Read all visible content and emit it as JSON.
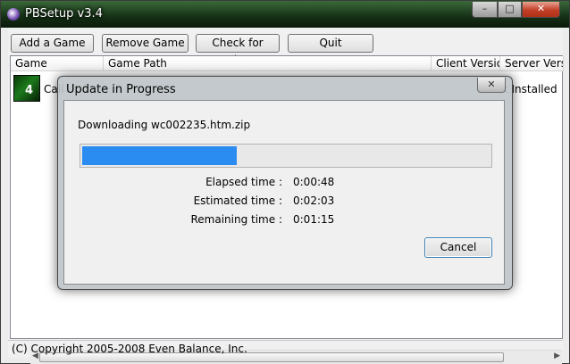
{
  "window": {
    "title": "PBSetup v3.4",
    "min_glyph": "–",
    "max_glyph": "□",
    "close_glyph": "✕"
  },
  "toolbar": {
    "add_label": "Add a Game",
    "remove_label": "Remove Game",
    "check_label": "Check for Updates",
    "quit_label": "Quit"
  },
  "list": {
    "headers": [
      "Game",
      "Game Path",
      "Client Version",
      "Server Version"
    ],
    "rows": [
      {
        "game": "Call",
        "path": "",
        "client": "",
        "server": "t Installed",
        "icon": "game-logo-icon",
        "icon_glyph": "4"
      }
    ]
  },
  "status": {
    "text": "(C) Copyright 2005-2008 Even Balance, Inc."
  },
  "dialog": {
    "title": "Update in Progress",
    "close_glyph": "✕",
    "downloading": "Downloading wc002235.htm.zip",
    "progress": 0.38,
    "accent": "#2a8cf0",
    "elapsed_label": "Elapsed time :",
    "elapsed_value": "0:00:48",
    "estimated_label": "Estimated time :",
    "estimated_value": "0:02:03",
    "remaining_label": "Remaining time :",
    "remaining_value": "0:01:15",
    "cancel_label": "Cancel"
  }
}
